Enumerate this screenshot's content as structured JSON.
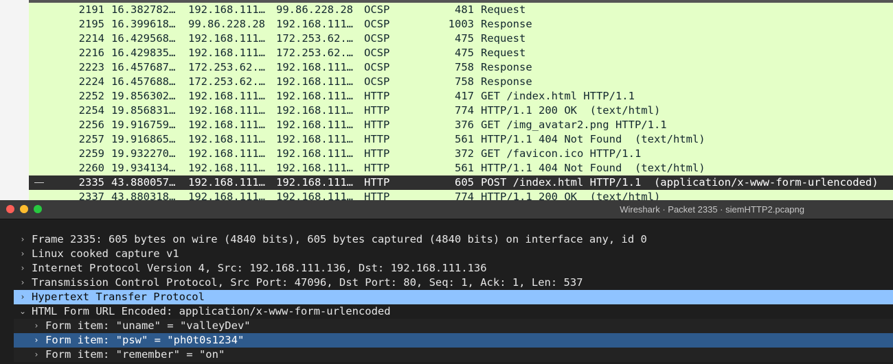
{
  "packet_list": {
    "rows": [
      {
        "no": "2191",
        "time": "16.382782…",
        "src": "192.168.111…",
        "dst": "99.86.228.28",
        "proto": "OCSP",
        "len": "481",
        "info": "Request"
      },
      {
        "no": "2195",
        "time": "16.399618…",
        "src": "99.86.228.28",
        "dst": "192.168.111…",
        "proto": "OCSP",
        "len": "1003",
        "info": "Response"
      },
      {
        "no": "2214",
        "time": "16.429568…",
        "src": "192.168.111…",
        "dst": "172.253.62.…",
        "proto": "OCSP",
        "len": "475",
        "info": "Request"
      },
      {
        "no": "2216",
        "time": "16.429835…",
        "src": "192.168.111…",
        "dst": "172.253.62.…",
        "proto": "OCSP",
        "len": "475",
        "info": "Request"
      },
      {
        "no": "2223",
        "time": "16.457687…",
        "src": "172.253.62.…",
        "dst": "192.168.111…",
        "proto": "OCSP",
        "len": "758",
        "info": "Response"
      },
      {
        "no": "2224",
        "time": "16.457688…",
        "src": "172.253.62.…",
        "dst": "192.168.111…",
        "proto": "OCSP",
        "len": "758",
        "info": "Response"
      },
      {
        "no": "2252",
        "time": "19.856302…",
        "src": "192.168.111…",
        "dst": "192.168.111…",
        "proto": "HTTP",
        "len": "417",
        "info": "GET /index.html HTTP/1.1"
      },
      {
        "no": "2254",
        "time": "19.856831…",
        "src": "192.168.111…",
        "dst": "192.168.111…",
        "proto": "HTTP",
        "len": "774",
        "info": "HTTP/1.1 200 OK  (text/html)"
      },
      {
        "no": "2256",
        "time": "19.916759…",
        "src": "192.168.111…",
        "dst": "192.168.111…",
        "proto": "HTTP",
        "len": "376",
        "info": "GET /img_avatar2.png HTTP/1.1"
      },
      {
        "no": "2257",
        "time": "19.916865…",
        "src": "192.168.111…",
        "dst": "192.168.111…",
        "proto": "HTTP",
        "len": "561",
        "info": "HTTP/1.1 404 Not Found  (text/html)"
      },
      {
        "no": "2259",
        "time": "19.932270…",
        "src": "192.168.111…",
        "dst": "192.168.111…",
        "proto": "HTTP",
        "len": "372",
        "info": "GET /favicon.ico HTTP/1.1"
      },
      {
        "no": "2260",
        "time": "19.934134…",
        "src": "192.168.111…",
        "dst": "192.168.111…",
        "proto": "HTTP",
        "len": "561",
        "info": "HTTP/1.1 404 Not Found  (text/html)"
      },
      {
        "no": "2335",
        "time": "43.880057…",
        "src": "192.168.111…",
        "dst": "192.168.111…",
        "proto": "HTTP",
        "len": "605",
        "info": "POST /index.html HTTP/1.1  (application/x-www-form-urlencoded)",
        "selected": true
      },
      {
        "no": "2337",
        "time": "43.880318…",
        "src": "192.168.111…",
        "dst": "192.168.111…",
        "proto": "HTTP",
        "len": "774",
        "info": "HTTP/1.1 200 OK  (text/html)"
      }
    ]
  },
  "details_window": {
    "title": "Wireshark · Packet 2335 · siemHTTP2.pcapng",
    "tree": [
      {
        "label": "Frame 2335: 605 bytes on wire (4840 bits), 605 bytes captured (4840 bits) on interface any, id 0",
        "level": 0,
        "expanded": false
      },
      {
        "label": "Linux cooked capture v1",
        "level": 0,
        "expanded": false
      },
      {
        "label": "Internet Protocol Version 4, Src: 192.168.111.136, Dst: 192.168.111.136",
        "level": 0,
        "expanded": false
      },
      {
        "label": "Transmission Control Protocol, Src Port: 47096, Dst Port: 80, Seq: 1, Ack: 1, Len: 537",
        "level": 0,
        "expanded": false
      },
      {
        "label": "Hypertext Transfer Protocol",
        "level": 0,
        "expanded": false,
        "highlight": true
      },
      {
        "label": "HTML Form URL Encoded: application/x-www-form-urlencoded",
        "level": 0,
        "expanded": true
      },
      {
        "label": "Form item: \"uname\" = \"valleyDev\"",
        "level": 1,
        "expanded": false
      },
      {
        "label": "Form item: \"psw\" = \"ph0t0s1234\"",
        "level": 1,
        "expanded": false,
        "selected": true
      },
      {
        "label": "Form item: \"remember\" = \"on\"",
        "level": 1,
        "expanded": false
      }
    ]
  },
  "icons": {
    "collapsed": "chevron-right-icon",
    "expanded": "chevron-down-icon"
  },
  "colors": {
    "packet_row_bg": "#e4ffc7",
    "selected_packet_bg": "#2f2f2f",
    "highlight_tree_bg": "#8fc3ff",
    "selected_tree_bg": "#2e5a8c"
  }
}
